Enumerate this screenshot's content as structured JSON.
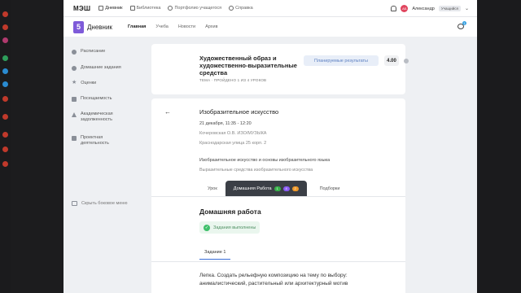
{
  "colors": {
    "accent_purple": "#7e5bd9",
    "tab_active_bg": "#3b3f46",
    "success_green": "#3ec06a",
    "plan_button_text": "#5b7fc1",
    "badge_green": "#38b24a",
    "badge_purple": "#8b5cf6",
    "badge_orange": "#f09a2a"
  },
  "topbar": {
    "brand": "МЭШ",
    "nav": [
      {
        "label": "Дневник",
        "icon": "diary-icon"
      },
      {
        "label": "Библиотека",
        "icon": "library-icon"
      },
      {
        "label": "Портфолио учащегося",
        "icon": "portfolio-icon"
      },
      {
        "label": "Справка",
        "icon": "help-icon"
      }
    ],
    "avatar_initials": "АБ",
    "user_name": "Александр",
    "user_role": "Учащийся"
  },
  "subbar": {
    "logo_number": "5",
    "app_name": "Дневник",
    "nav": [
      "Главная",
      "Учеба",
      "Новости",
      "Архив"
    ],
    "chat_count": "1"
  },
  "sidebar": {
    "items": [
      {
        "label": "Расписание",
        "icon": "calendar-icon"
      },
      {
        "label": "Домашние задания",
        "icon": "homework-icon"
      },
      {
        "label": "Оценки",
        "icon": "star-icon"
      },
      {
        "label": "Посещаемость",
        "icon": "flag-icon"
      },
      {
        "label": "Академическая задолженность",
        "icon": "warning-icon"
      },
      {
        "label": "Проектная деятельность",
        "icon": "briefcase-icon"
      }
    ],
    "hide_label": "Скрыть боковое меню"
  },
  "lesson_header": {
    "title": "Художественный образ и художественно-выразительные средства",
    "subtitle": "ТЕМА · ПРОЙДЕНО 1 ИЗ 4 УРОКОВ",
    "plan_button": "Планируемые результаты",
    "score": "4.00"
  },
  "lesson": {
    "title": "Изобразительное искусство",
    "date": "21 декабря, 11:35 - 12:20",
    "teacher": "Кочеровская О.В. ИЗО/МУЗЫКА",
    "address": "Краснодарская улица 25 корп. 2",
    "topic": "Изобразительное искусство и основы изобразительного языка",
    "subtopic": "Выразительные средства изобразительного искусства",
    "tabs": [
      "Урок",
      "Домашняя Работа",
      "Подборки"
    ],
    "badges": [
      "1",
      "4",
      "2"
    ]
  },
  "homework": {
    "title": "Домашняя работа",
    "status": "Задания выполнены",
    "task_tab": "Задание 1",
    "task_text": "Лепка. Создать рельефную композицию на тему по выбору: анималистический, растительный или архитектурный мотив"
  }
}
